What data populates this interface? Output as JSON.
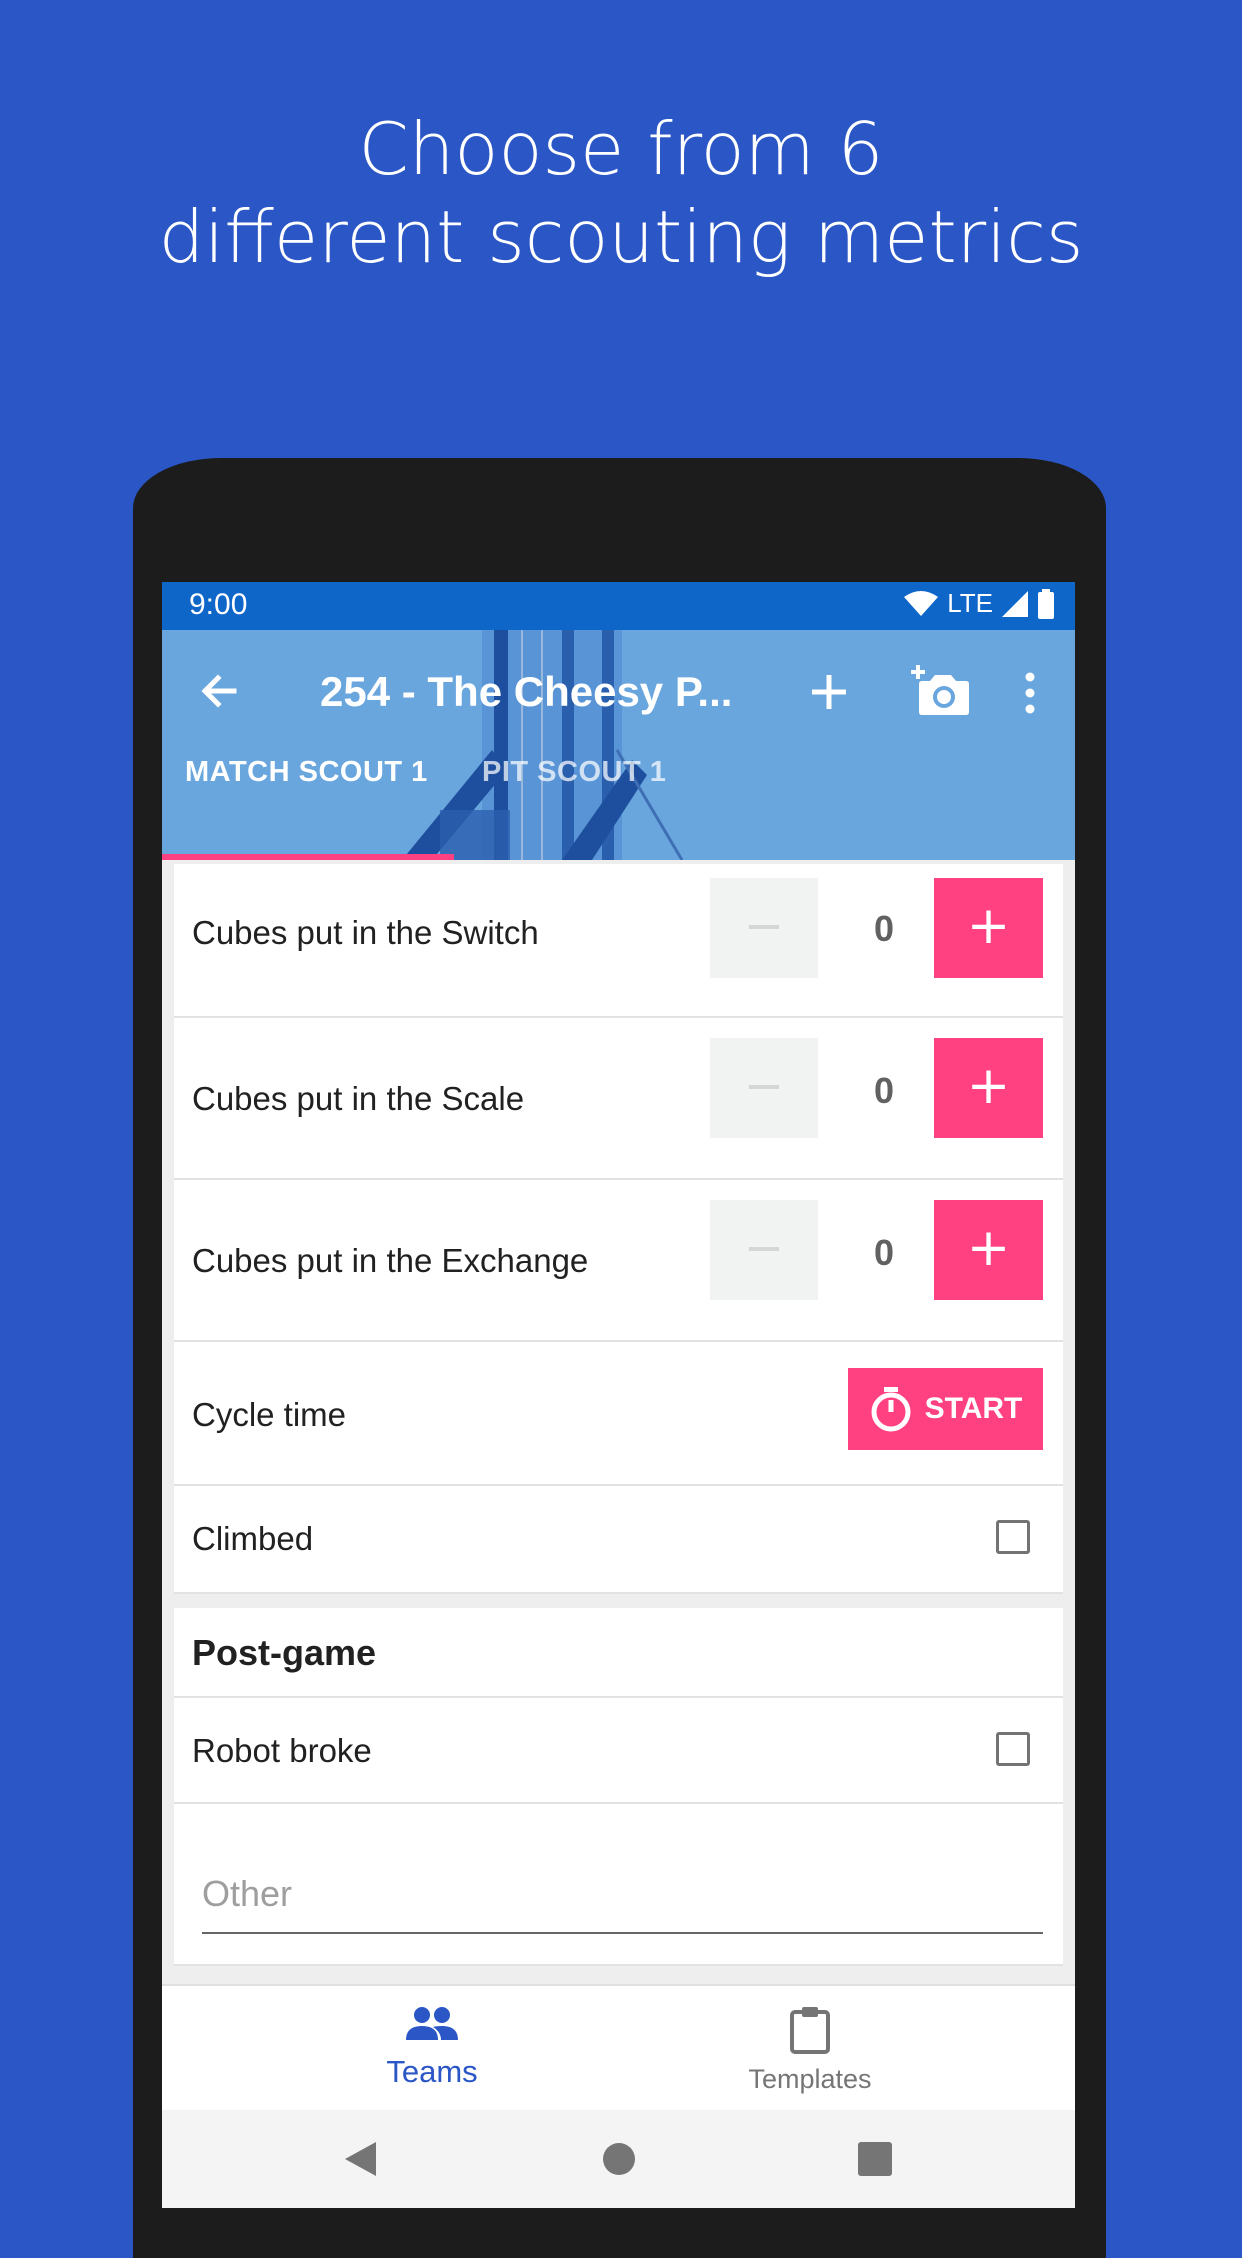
{
  "promo": {
    "line1": "Choose from 6",
    "line2": "different scouting metrics"
  },
  "status_bar": {
    "time": "9:00",
    "network": "LTE"
  },
  "app_bar": {
    "title": "254 - The Cheesy P...",
    "icons": [
      "arrow-back-icon",
      "add-icon",
      "add-photo-icon",
      "more-vert-icon"
    ]
  },
  "tabs": [
    {
      "label": "MATCH SCOUT 1",
      "selected": true
    },
    {
      "label": "PIT SCOUT 1",
      "selected": false
    }
  ],
  "metrics": [
    {
      "label": "Cubes put in the Switch",
      "value": "0",
      "minus": "−",
      "plus": "+"
    },
    {
      "label": "Cubes put in the Scale",
      "value": "0",
      "minus": "−",
      "plus": "+"
    },
    {
      "label": "Cubes put in the Exchange",
      "value": "0",
      "minus": "−",
      "plus": "+"
    }
  ],
  "timer": {
    "label": "Cycle time",
    "button": "START"
  },
  "checkboxes": {
    "climbed": {
      "label": "Climbed",
      "checked": false
    },
    "robot_broke": {
      "label": "Robot broke",
      "checked": false
    }
  },
  "section_post_game": "Post-game",
  "other_field": {
    "placeholder": "Other",
    "value": ""
  },
  "bottom_nav": [
    {
      "label": "Teams",
      "active": true
    },
    {
      "label": "Templates",
      "active": false
    }
  ],
  "colors": {
    "background": "#2b56c6",
    "status_bar": "#0f66c9",
    "app_bar": "#6aa6de",
    "accent": "#ff4081",
    "nav_active": "#2b56c6"
  }
}
